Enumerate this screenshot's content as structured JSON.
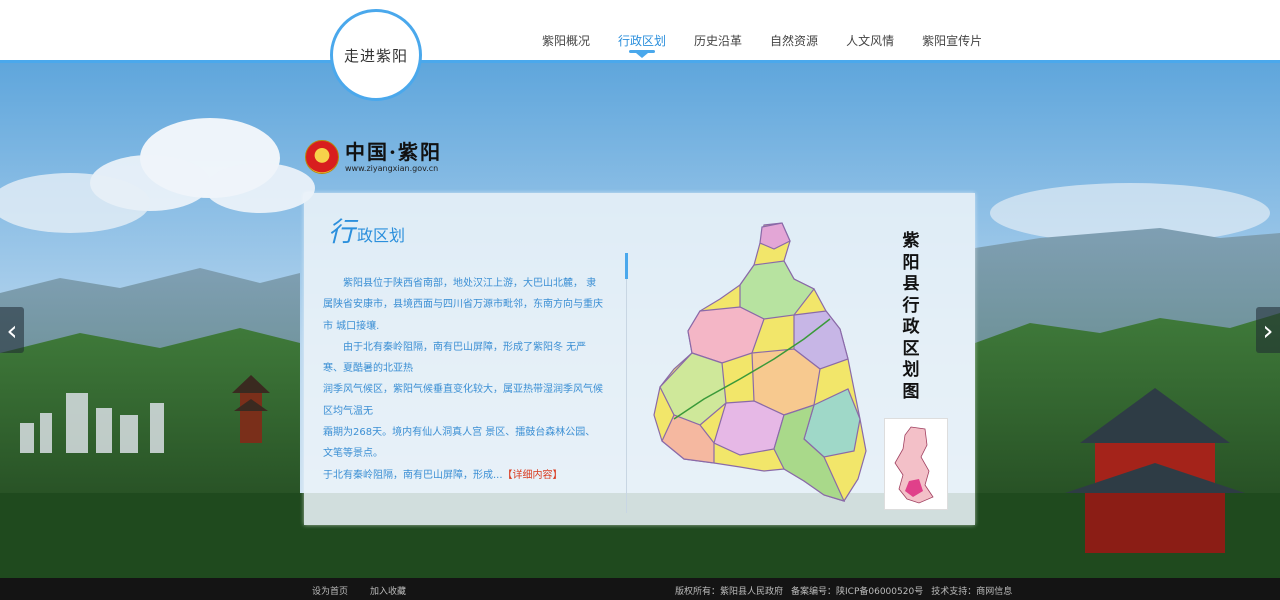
{
  "header": {
    "logo_text": "走进紫阳",
    "nav": [
      {
        "label": "紫阳概况",
        "active": false
      },
      {
        "label": "行政区划",
        "active": true
      },
      {
        "label": "历史沿革",
        "active": false
      },
      {
        "label": "自然资源",
        "active": false
      },
      {
        "label": "人文风情",
        "active": false
      },
      {
        "label": "紫阳宣传片",
        "active": false
      }
    ]
  },
  "colors": {
    "accent": "#4aa8ec",
    "text_blue": "#3b8fd4",
    "link_red": "#d93a1f",
    "footer_bg": "#141414"
  },
  "brand": {
    "name": "中国·紫阳",
    "url": "www.ziyangxian.gov.cn"
  },
  "section": {
    "title_first": "行",
    "title_rest": "政区划",
    "paragraphs": [
      "紫阳县位于陕西省南部，地处汉江上游，大巴山北麓， 隶属陕省安康市，县境西面与四川省万源市毗邻，东南方向与重庆市 城口接壤.",
      "由于北有秦岭阻隔，南有巴山屏障，形成了紫阳冬 无严寒、夏酷暑的北亚热",
      "润季风气候区，紫阳气候垂直变化较大，属亚热带湿润季风气候 区均气温无",
      "霜期为268天。境内有仙人洞真人宫 景区、擂鼓台森林公园、文笔等景点。",
      "于北有秦岭阻隔，南有巴山屏障，形成..."
    ],
    "more_label": "【详细内容】",
    "map_title": "紫阳县行政区划图"
  },
  "arrows": {
    "left": "‹",
    "right": "›"
  },
  "footer": {
    "set_home": "设为首页",
    "add_favorite": "加入收藏",
    "copyright": "版权所有：紫阳县人民政府",
    "icp": "备案编号：陕ICP备06000520号",
    "support": "技术支持：商网信息"
  }
}
